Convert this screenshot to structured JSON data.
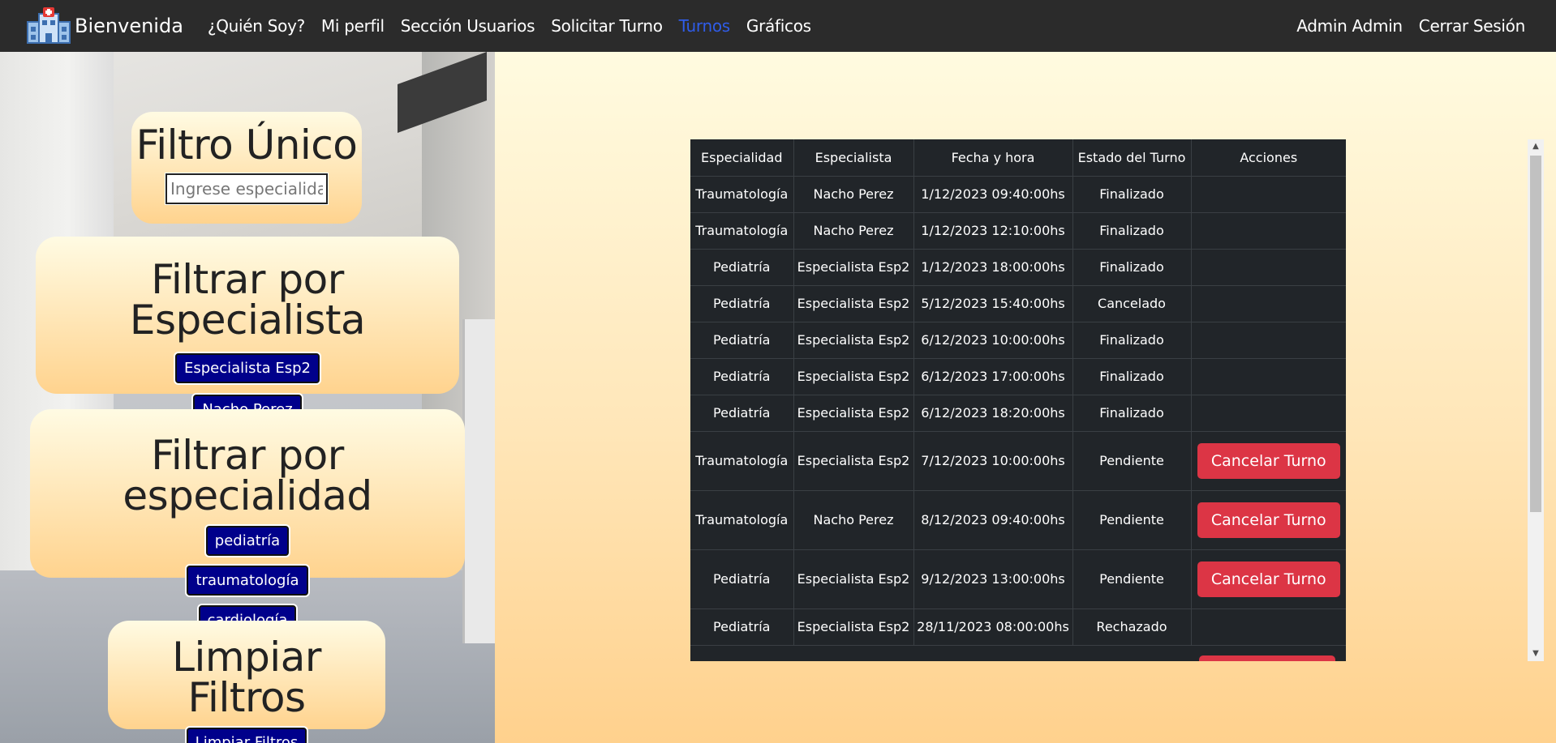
{
  "navbar": {
    "brand": "Bienvenida",
    "links": [
      "¿Quién Soy?",
      "Mi perfil",
      "Sección Usuarios",
      "Solicitar Turno",
      "Turnos",
      "Gráficos"
    ],
    "active_link": "Turnos",
    "user": "Admin Admin",
    "logout": "Cerrar Sesión",
    "colors": {
      "background": "#2b2b2b",
      "active": "#2f5ce8"
    }
  },
  "filters": {
    "unique": {
      "title": "Filtro Único",
      "placeholder": "Ingrese especialidad"
    },
    "specialist": {
      "title": "Filtrar por Especialista",
      "options": [
        "Especialista Esp2",
        "Nacho Perez"
      ]
    },
    "specialty": {
      "title": "Filtrar por especialidad",
      "options": [
        "pediatría",
        "traumatología",
        "cardiología"
      ]
    },
    "clear": {
      "title": "Limpiar Filtros",
      "button": "Limpiar Filtros"
    },
    "chip_color": "#00008b"
  },
  "table": {
    "headers": [
      "Especialidad",
      "Especialista",
      "Fecha y hora",
      "Estado del Turno",
      "Acciones"
    ],
    "cancel_label": "Cancelar Turno",
    "cancel_color": "#dc3545",
    "rows": [
      {
        "especialidad": "Traumatología",
        "especialista": "Nacho Perez",
        "fecha": "1/12/2023 09:40:00hs",
        "estado": "Finalizado",
        "accion": ""
      },
      {
        "especialidad": "Traumatología",
        "especialista": "Nacho Perez",
        "fecha": "1/12/2023 12:10:00hs",
        "estado": "Finalizado",
        "accion": ""
      },
      {
        "especialidad": "Pediatría",
        "especialista": "Especialista Esp2",
        "fecha": "1/12/2023 18:00:00hs",
        "estado": "Finalizado",
        "accion": ""
      },
      {
        "especialidad": "Pediatría",
        "especialista": "Especialista Esp2",
        "fecha": "5/12/2023 15:40:00hs",
        "estado": "Cancelado",
        "accion": ""
      },
      {
        "especialidad": "Pediatría",
        "especialista": "Especialista Esp2",
        "fecha": "6/12/2023 10:00:00hs",
        "estado": "Finalizado",
        "accion": ""
      },
      {
        "especialidad": "Pediatría",
        "especialista": "Especialista Esp2",
        "fecha": "6/12/2023 17:00:00hs",
        "estado": "Finalizado",
        "accion": ""
      },
      {
        "especialidad": "Pediatría",
        "especialista": "Especialista Esp2",
        "fecha": "6/12/2023 18:20:00hs",
        "estado": "Finalizado",
        "accion": ""
      },
      {
        "especialidad": "Traumatología",
        "especialista": "Especialista Esp2",
        "fecha": "7/12/2023 10:00:00hs",
        "estado": "Pendiente",
        "accion": "Cancelar Turno"
      },
      {
        "especialidad": "Traumatología",
        "especialista": "Nacho Perez",
        "fecha": "8/12/2023 09:40:00hs",
        "estado": "Pendiente",
        "accion": "Cancelar Turno"
      },
      {
        "especialidad": "Pediatría",
        "especialista": "Especialista Esp2",
        "fecha": "9/12/2023 13:00:00hs",
        "estado": "Pendiente",
        "accion": "Cancelar Turno"
      },
      {
        "especialidad": "Pediatría",
        "especialista": "Especialista Esp2",
        "fecha": "28/11/2023 08:00:00hs",
        "estado": "Rechazado",
        "accion": ""
      }
    ]
  }
}
